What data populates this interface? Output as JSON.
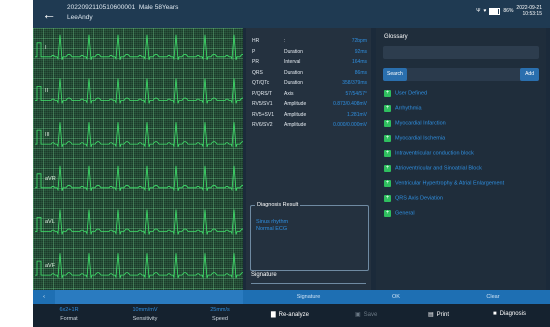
{
  "header": {
    "patient_id": "2022092110510600001",
    "patient_info": "Male 58Years",
    "patient_name": "LeeAndy",
    "battery_percent": "86%",
    "date": "2022-09-21",
    "time": "10:53:15"
  },
  "ecg": {
    "leads": [
      "I",
      "II",
      "III",
      "aVR",
      "aVL",
      "aVF"
    ]
  },
  "measurements": [
    {
      "key": "HR",
      "type": ":",
      "value": "72bpm"
    },
    {
      "key": "P",
      "type": "Duration",
      "value": "92ms"
    },
    {
      "key": "PR",
      "type": "Interval",
      "value": "164ms"
    },
    {
      "key": "QRS",
      "type": "Duration",
      "value": "86ms"
    },
    {
      "key": "QT/QTc",
      "type": "Duration",
      "value": "358/379ms"
    },
    {
      "key": "P/QRS/T",
      "type": "Axis",
      "value": "57/54/57°"
    },
    {
      "key": "RV5/SV1",
      "type": "Amplitude",
      "value": "0.873/0.408mV"
    },
    {
      "key": "RV5+SV1",
      "type": "Amplitude",
      "value": "1.281mV"
    },
    {
      "key": "RV6/SV2",
      "type": "Amplitude",
      "value": "0.000/0.000mV"
    }
  ],
  "diagnosis": {
    "title": "Diagnosis Result",
    "lines": [
      "Sinus rhythm",
      "Normal ECG"
    ],
    "signature_label": "Signature"
  },
  "glossary": {
    "title": "Glossary",
    "search_label": "Search",
    "add_label": "Add",
    "items": [
      "User Defined",
      "Arrhythmia",
      "Myocardial Infarction",
      "Myocardial Ischemia",
      "Intraventricular conduction block",
      "Atrioventricular and Sinoatrial Block",
      "Ventricular Hypertrophy & Atrial Enlargement",
      "QRS Axis Deviation",
      "General"
    ]
  },
  "action_bar": {
    "signature": "Signature",
    "ok": "OK",
    "clear": "Clear"
  },
  "bottom_bar": {
    "format": {
      "value": "6x2+1R",
      "label": "Format"
    },
    "sensitivity": {
      "value": "10mm/mV",
      "label": "Sensitivity"
    },
    "speed": {
      "value": "25mm/s",
      "label": "Speed"
    },
    "reanalyze": "Re-analyze",
    "save": "Save",
    "print": "Print",
    "diagnosis": "Diagnosis"
  },
  "colors": {
    "accent_blue": "#1e6fb3",
    "value_blue": "#2f8fe0",
    "ecg_trace": "#3fe06a",
    "glossary_plus": "#2fbf5f"
  }
}
